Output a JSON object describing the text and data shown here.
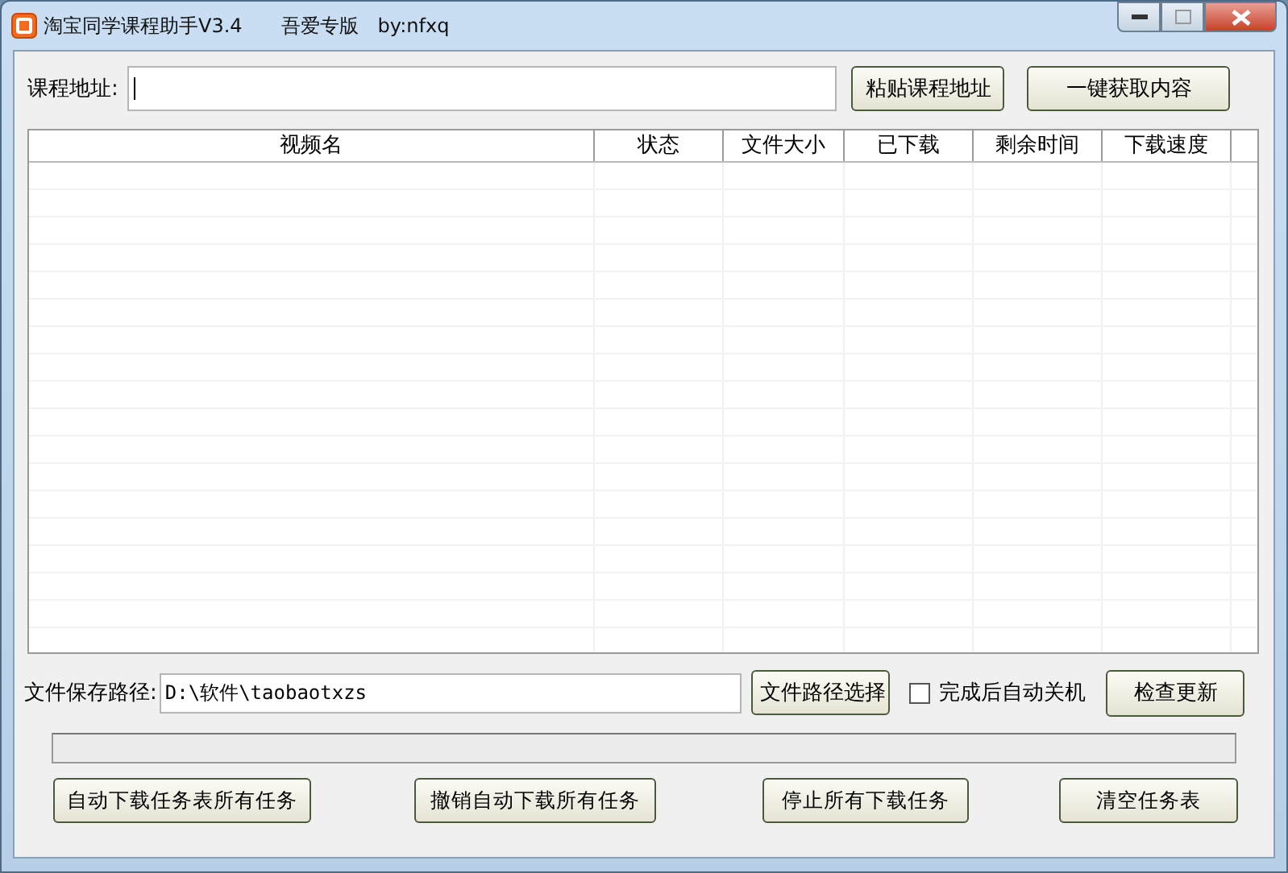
{
  "window": {
    "title": "淘宝同学课程助手V3.4",
    "subtitle": "吾爱专版",
    "author": "by:nfxq"
  },
  "url_row": {
    "label": "课程地址:",
    "buttons": [
      "粘贴课程地址",
      "一键获取内容"
    ]
  },
  "table": {
    "columns": [
      "视频名",
      "状态",
      "文件大小",
      "已下载",
      "剩余时间",
      "下载速度"
    ]
  },
  "path_row": {
    "label": "文件保存路径:",
    "value": "D:\\软件\\taobaotxzs",
    "button": "文件路径选择",
    "shutdown": {
      "label": "完成后自动关机",
      "checked": false
    },
    "update_button": "检查更新"
  },
  "progress": {
    "level": 0
  },
  "buttons": [
    "自动下载任务表所有任务",
    "撤销自动下载所有任务",
    "停止所有下载任务",
    "清空任务表"
  ]
}
